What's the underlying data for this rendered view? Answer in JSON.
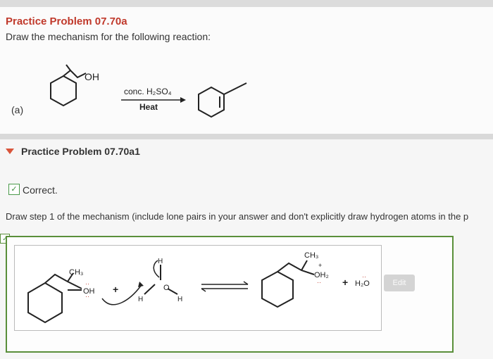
{
  "problem": {
    "title": "Practice Problem 07.70a",
    "instructions": "Draw the mechanism for the following reaction:",
    "part_label": "(a)",
    "reagent_line1": "conc. H₂SO₄",
    "reagent_line2": "Heat",
    "reactant_group": "OH"
  },
  "subproblem": {
    "title": "Practice Problem 07.70a1",
    "status": "Correct.",
    "step_text": "Draw step 1 of the mechanism (include lone pairs in your answer and don't explicitly draw hydrogen atoms in the p",
    "edit_label": "Edit"
  },
  "mechanism": {
    "ch3_left": "CH₃",
    "oh_left": "OH",
    "plus": "+",
    "h_top": "H",
    "h_left": "H",
    "h_right": "H",
    "o_middle": "O",
    "ch3_right": "CH₃",
    "oh2_right": "OH₂",
    "plus_charge": "+",
    "plus2": "+",
    "water": "H₂O"
  },
  "colors": {
    "title": "#c0392b",
    "correct_green": "#5a8f3a",
    "triangle": "#d9543a"
  }
}
